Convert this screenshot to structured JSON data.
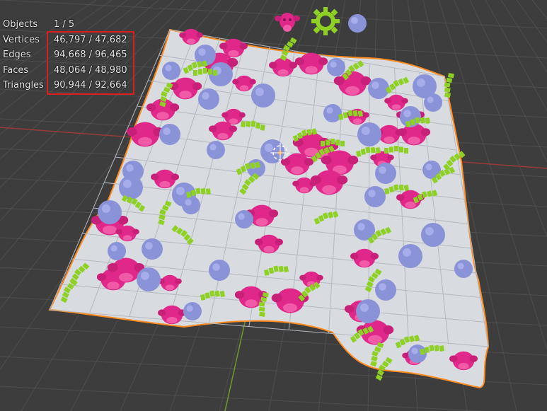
{
  "statistics": {
    "objects": {
      "label": "Objects",
      "value": "1 / 5"
    },
    "vertices": {
      "label": "Vertices",
      "value": "46,797 / 47,682"
    },
    "edges": {
      "label": "Edges",
      "value": "94,668 / 96,465"
    },
    "faces": {
      "label": "Faces",
      "value": "48,064 / 48,980"
    },
    "triangles": {
      "label": "Triangles",
      "value": "90,944 / 92,664"
    }
  },
  "colors": {
    "background": "#3d3d3d",
    "grid_line": "#5a5a5a",
    "x_axis": "#9b3a3a",
    "y_axis": "#6e9a2c",
    "plane": "#d8dbe0",
    "selection_outline": "#ff8a1e",
    "highlight_box": "#d91f1f",
    "monkey": "#e0278a",
    "sphere": "#8b93d8",
    "gear": "#8ed124"
  },
  "scene_icons": [
    "monkey-icon",
    "gear-icon",
    "sphere-icon"
  ]
}
